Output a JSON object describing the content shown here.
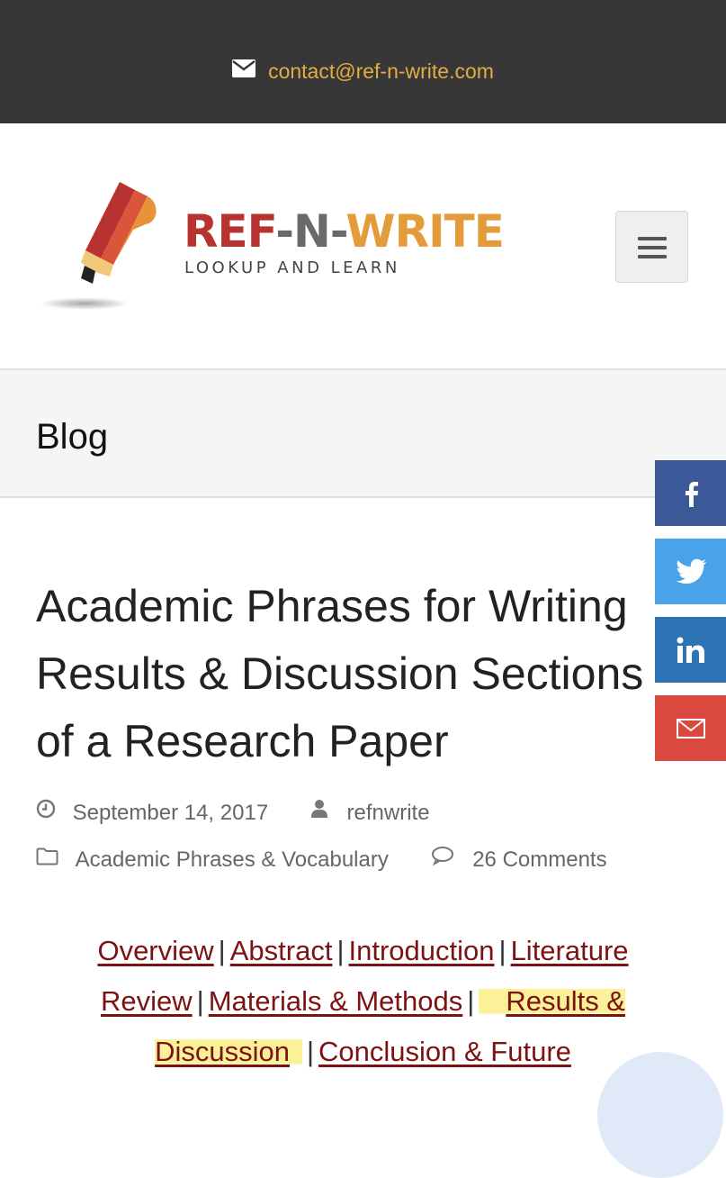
{
  "topbar": {
    "email": "contact@ref-n-write.com",
    "icon": "envelope-icon"
  },
  "header": {
    "brand": {
      "part1": "REF",
      "dash1": "-",
      "part2": "N",
      "dash2": "-",
      "part3": "WRITE"
    },
    "tagline": "LOOKUP AND LEARN",
    "menu_icon": "hamburger-icon"
  },
  "page": {
    "section_title": "Blog"
  },
  "social": [
    {
      "name": "facebook",
      "icon": "facebook-icon",
      "color": "#3b5998"
    },
    {
      "name": "twitter",
      "icon": "twitter-icon",
      "color": "#4aa3e8"
    },
    {
      "name": "linkedin",
      "icon": "linkedin-icon",
      "color": "#2e74b5"
    },
    {
      "name": "email",
      "icon": "envelope-icon",
      "color": "#d9493f"
    }
  ],
  "post": {
    "title": "Academic Phrases for Writing Results & Discussion Sections of a Research Paper",
    "date": "September 14, 2017",
    "author": "refnwrite",
    "category": "Academic Phrases & Vocabulary",
    "comments": "26 Comments"
  },
  "toc": {
    "links": [
      "Overview",
      "Abstract",
      "Introduction",
      "Literature Review",
      "Materials & Methods",
      "Results & Discussion",
      "Conclusion & Future"
    ],
    "separator": "|",
    "highlight_color": "#fbf199",
    "link_color": "#7d1212"
  }
}
